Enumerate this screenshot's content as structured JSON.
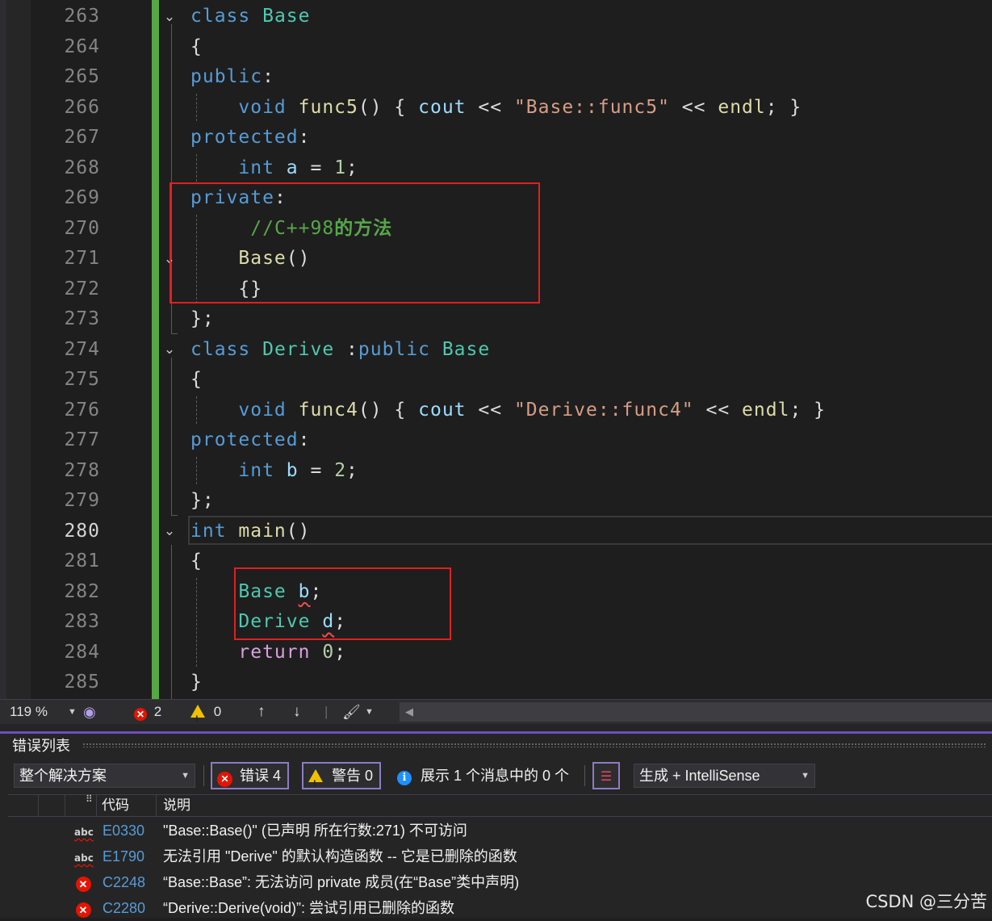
{
  "editor": {
    "lines": [
      {
        "num": "263",
        "current": false,
        "tokens": [
          [
            "class ",
            "tok-kw"
          ],
          [
            "Base",
            "tok-type"
          ]
        ]
      },
      {
        "num": "264",
        "current": false,
        "tokens": [
          [
            "{",
            "tok-punct"
          ]
        ]
      },
      {
        "num": "265",
        "current": false,
        "tokens": [
          [
            "public",
            "tok-kw"
          ],
          [
            ":",
            "tok-punct"
          ]
        ]
      },
      {
        "num": "266",
        "current": false,
        "tokens": [
          [
            "    ",
            ""
          ],
          [
            "void ",
            "tok-kw"
          ],
          [
            "func5",
            "tok-fn"
          ],
          [
            "() { ",
            "tok-punct"
          ],
          [
            "cout ",
            "tok-var"
          ],
          [
            "<< ",
            "tok-punct"
          ],
          [
            "\"Base::func5\"",
            "tok-str"
          ],
          [
            " << ",
            "tok-punct"
          ],
          [
            "endl",
            "tok-fn"
          ],
          [
            "; }",
            "tok-punct"
          ]
        ]
      },
      {
        "num": "267",
        "current": false,
        "tokens": [
          [
            "protected",
            "tok-kw"
          ],
          [
            ":",
            "tok-punct"
          ]
        ]
      },
      {
        "num": "268",
        "current": false,
        "tokens": [
          [
            "    ",
            ""
          ],
          [
            "int ",
            "tok-kw"
          ],
          [
            "a",
            "tok-var"
          ],
          [
            " = ",
            "tok-punct"
          ],
          [
            "1",
            "tok-num"
          ],
          [
            ";",
            "tok-punct"
          ]
        ]
      },
      {
        "num": "269",
        "current": false,
        "tokens": [
          [
            "private",
            "tok-kw"
          ],
          [
            ":",
            "tok-punct"
          ]
        ]
      },
      {
        "num": "270",
        "current": false,
        "tokens": [
          [
            "     ",
            ""
          ],
          [
            "//C++98",
            "tok-cmt"
          ],
          [
            "的方法",
            "tok-cmt-cjk"
          ]
        ]
      },
      {
        "num": "271",
        "current": false,
        "tokens": [
          [
            "    ",
            ""
          ],
          [
            "Base",
            "tok-fn"
          ],
          [
            "()",
            "tok-punct"
          ]
        ]
      },
      {
        "num": "272",
        "current": false,
        "tokens": [
          [
            "    ",
            ""
          ],
          [
            "{}",
            "tok-punct"
          ]
        ]
      },
      {
        "num": "273",
        "current": false,
        "tokens": [
          [
            "};",
            "tok-punct"
          ]
        ]
      },
      {
        "num": "274",
        "current": false,
        "tokens": [
          [
            "class ",
            "tok-kw"
          ],
          [
            "Derive ",
            "tok-type"
          ],
          [
            ":",
            "tok-punct"
          ],
          [
            "public ",
            "tok-kw"
          ],
          [
            "Base",
            "tok-type"
          ]
        ]
      },
      {
        "num": "275",
        "current": false,
        "tokens": [
          [
            "{",
            "tok-punct"
          ]
        ]
      },
      {
        "num": "276",
        "current": false,
        "tokens": [
          [
            "    ",
            ""
          ],
          [
            "void ",
            "tok-kw"
          ],
          [
            "func4",
            "tok-fn"
          ],
          [
            "() { ",
            "tok-punct"
          ],
          [
            "cout ",
            "tok-var"
          ],
          [
            "<< ",
            "tok-punct"
          ],
          [
            "\"Derive::func4\"",
            "tok-str"
          ],
          [
            " << ",
            "tok-punct"
          ],
          [
            "endl",
            "tok-fn"
          ],
          [
            "; }",
            "tok-punct"
          ]
        ]
      },
      {
        "num": "277",
        "current": false,
        "tokens": [
          [
            "protected",
            "tok-kw"
          ],
          [
            ":",
            "tok-punct"
          ]
        ]
      },
      {
        "num": "278",
        "current": false,
        "tokens": [
          [
            "    ",
            ""
          ],
          [
            "int ",
            "tok-kw"
          ],
          [
            "b",
            "tok-var"
          ],
          [
            " = ",
            "tok-punct"
          ],
          [
            "2",
            "tok-num"
          ],
          [
            ";",
            "tok-punct"
          ]
        ]
      },
      {
        "num": "279",
        "current": false,
        "tokens": [
          [
            "};",
            "tok-punct"
          ]
        ]
      },
      {
        "num": "280",
        "current": true,
        "tokens": [
          [
            "int ",
            "tok-kw"
          ],
          [
            "main",
            "tok-fn"
          ],
          [
            "()",
            "tok-punct"
          ]
        ]
      },
      {
        "num": "281",
        "current": false,
        "tokens": [
          [
            "{",
            "tok-punct"
          ]
        ]
      },
      {
        "num": "282",
        "current": false,
        "tokens": [
          [
            "    ",
            ""
          ],
          [
            "Base ",
            "tok-type"
          ],
          [
            "b",
            "tok-var squiggle"
          ],
          [
            ";",
            "tok-punct"
          ]
        ]
      },
      {
        "num": "283",
        "current": false,
        "tokens": [
          [
            "    ",
            ""
          ],
          [
            "Derive ",
            "tok-type"
          ],
          [
            "d",
            "tok-var squiggle"
          ],
          [
            ";",
            "tok-punct"
          ]
        ]
      },
      {
        "num": "284",
        "current": false,
        "tokens": [
          [
            "    ",
            ""
          ],
          [
            "return ",
            "tok-kw2"
          ],
          [
            "0",
            "tok-num"
          ],
          [
            ";",
            "tok-punct"
          ]
        ]
      },
      {
        "num": "285",
        "current": false,
        "tokens": [
          [
            "}",
            "tok-punct"
          ]
        ]
      }
    ]
  },
  "status_bar": {
    "zoom": "119 %",
    "error_count": "2",
    "warning_count": "0",
    "up_arrow": "↑",
    "down_arrow": "↓"
  },
  "error_list": {
    "title": "错误列表",
    "scope": "整个解决方案",
    "errors_filter": "错误 4",
    "warnings_filter": "警告 0",
    "messages_filter": "展示 1 个消息中的 0 个",
    "source": "生成 + IntelliSense",
    "columns": {
      "code": "代码",
      "description": "说明"
    },
    "rows": [
      {
        "icon": "abc",
        "code": "E0330",
        "description": "\"Base::Base()\" (已声明 所在行数:271) 不可访问"
      },
      {
        "icon": "abc",
        "code": "E1790",
        "description": "无法引用 \"Derive\" 的默认构造函数 -- 它是已删除的函数"
      },
      {
        "icon": "error",
        "code": "C2248",
        "description": "“Base::Base”: 无法访问 private 成员(在“Base”类中声明)"
      },
      {
        "icon": "error",
        "code": "C2280",
        "description": "“Derive::Derive(void)”: 尝试引用已删除的函数"
      }
    ]
  },
  "watermark": "CSDN @三分苦",
  "icons": {
    "fold": "chevron-down-icon",
    "error": "error-circle-icon",
    "warning": "warning-triangle-icon",
    "info": "info-icon",
    "brush": "brush-icon",
    "filter_toggle": "filter-toggle-icon"
  },
  "colors": {
    "keyword": "#569cd6",
    "type": "#4ec9b0",
    "function": "#dcdcaa",
    "string": "#d69d85",
    "comment": "#57a64a",
    "change_bar": "#56a845",
    "highlight_box": "#e02020"
  }
}
